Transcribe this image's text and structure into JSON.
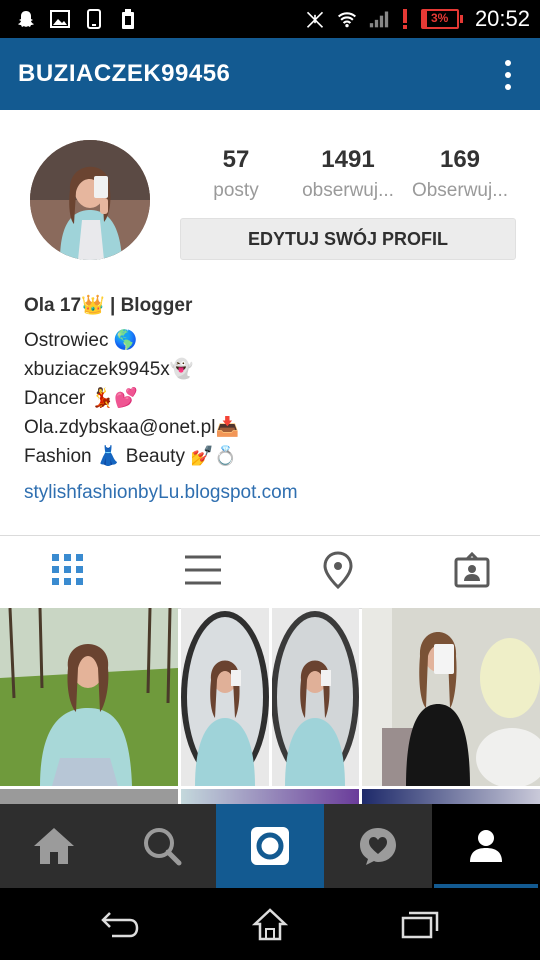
{
  "status_bar": {
    "time": "20:52",
    "battery_percent": "3%",
    "icons": [
      "snapchat-icon",
      "gallery-icon",
      "phone-icon",
      "battery-saver-icon",
      "no-signal-icon",
      "wifi-icon",
      "signal-icon",
      "alert-icon"
    ]
  },
  "app_bar": {
    "username": "BUZIACZEK99456",
    "menu_icon": "kebab-menu-icon"
  },
  "profile": {
    "stats": [
      {
        "value": "57",
        "label": "posty"
      },
      {
        "value": "1491",
        "label": "obserwuj..."
      },
      {
        "value": "169",
        "label": "Obserwuj..."
      }
    ],
    "edit_button": "EDYTUJ SWÓJ PROFIL",
    "bio": {
      "name": "Ola 17👑 | Blogger",
      "lines": [
        "Ostrowiec 🌎",
        " xbuziaczek9945x👻",
        "Dancer 💃💕",
        "Ola.zdybskaa@onet.pl📥",
        "Fashion 👗 Beauty 💅💍"
      ],
      "link": "stylishfashionbyLu.blogspot.com"
    }
  },
  "tabs": [
    "grid-icon",
    "list-icon",
    "location-icon",
    "tagged-icon"
  ],
  "bottom_nav": [
    "home-icon",
    "search-icon",
    "camera-icon",
    "activity-icon",
    "profile-icon"
  ],
  "colors": {
    "accent": "#135a91",
    "link": "#2f6fb0",
    "nav_bg": "#2e2e2e"
  }
}
